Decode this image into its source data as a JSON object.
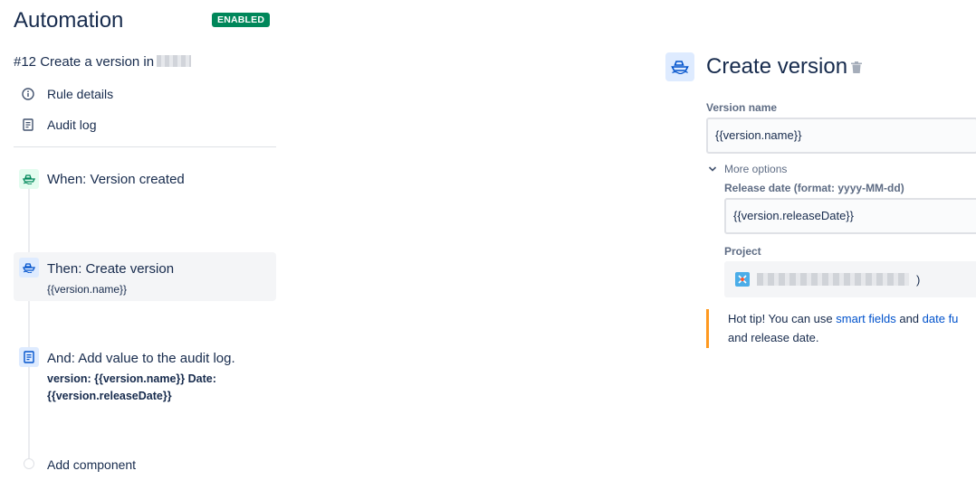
{
  "header": {
    "title": "Automation",
    "status": "ENABLED",
    "status_color": "#00875a"
  },
  "rule": {
    "title": "#12 Create a version in"
  },
  "nav": {
    "rule_details": "Rule details",
    "audit_log": "Audit log"
  },
  "steps": [
    {
      "title": "When: Version created",
      "icon": "ship-icon"
    },
    {
      "title": "Then: Create version",
      "subtitle": "{{version.name}}",
      "icon": "ship-icon"
    },
    {
      "title": "And: Add value to the audit log.",
      "subtitle_line1": "version: {{version.name}} Date:",
      "subtitle_line2": "{{version.releaseDate}}",
      "icon": "document-icon"
    }
  ],
  "add_component": "Add component",
  "panel": {
    "title": "Create version",
    "version_name_label": "Version name",
    "version_name_value": "{{version.name}}",
    "more_options": "More options",
    "release_date_label": "Release date (format: yyyy-MM-dd)",
    "release_date_value": "{{version.releaseDate}}",
    "project_label": "Project",
    "project_suffix": ")"
  },
  "tip": {
    "prefix": "Hot tip! You can use ",
    "link1": "smart fields",
    "middle": " and ",
    "link2": "date fu",
    "line2": "and release date."
  },
  "colors": {
    "accent": "#0052cc",
    "tip_border": "#ff991f"
  }
}
